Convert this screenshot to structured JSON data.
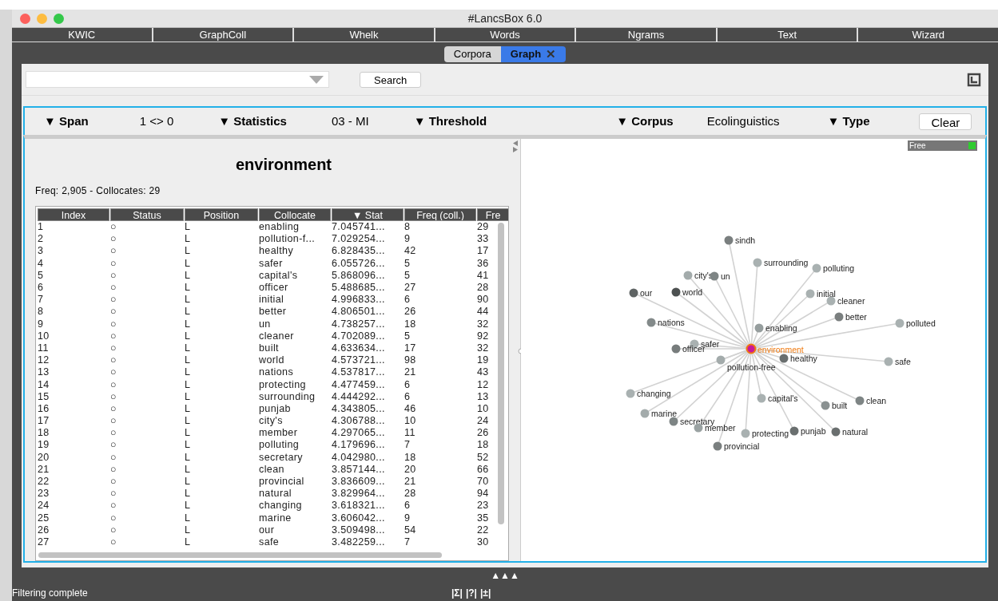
{
  "window": {
    "title": "#LancsBox 6.0"
  },
  "tools": [
    {
      "label": "KWIC",
      "selected": false
    },
    {
      "label": "GraphColl",
      "selected": false
    },
    {
      "label": "Whelk",
      "selected": false
    },
    {
      "label": "Words",
      "selected": false
    },
    {
      "label": "Ngrams",
      "selected": false
    },
    {
      "label": "Text",
      "selected": false
    },
    {
      "label": "Wizard",
      "selected": false
    }
  ],
  "subtabs": [
    {
      "label": "Corpora",
      "selected": false,
      "closable": false
    },
    {
      "label": "Graph",
      "selected": true,
      "closable": true,
      "close": "✕"
    }
  ],
  "search": {
    "button": "Search"
  },
  "filters": [
    {
      "kind": "dropdown",
      "label": "▼ Span"
    },
    {
      "kind": "value",
      "label": "1 <> 0"
    },
    {
      "kind": "dropdown",
      "label": "▼ Statistics"
    },
    {
      "kind": "value",
      "label": "03 - MI"
    },
    {
      "kind": "dropdown",
      "label": "▼ Threshold"
    },
    {
      "kind": "dropdown",
      "label": "▼ Corpus"
    },
    {
      "kind": "value",
      "label": "Ecolinguistics"
    },
    {
      "kind": "dropdown",
      "label": "▼ Type"
    },
    {
      "kind": "button",
      "label": "Clear"
    }
  ],
  "node_word": "environment",
  "summary": "Freq: 2,905 - Collocates: 29",
  "table": {
    "columns": [
      "Index",
      "Status",
      "Position",
      "Collocate",
      "▼ Stat",
      "Freq (coll.)",
      "Fre"
    ],
    "rows": [
      [
        "1",
        "○",
        "L",
        "enabling",
        "7.045741...",
        "8",
        "29"
      ],
      [
        "2",
        "○",
        "L",
        "pollution-f...",
        "7.029254...",
        "9",
        "33"
      ],
      [
        "3",
        "○",
        "L",
        "healthy",
        "6.828435...",
        "42",
        "17"
      ],
      [
        "4",
        "○",
        "L",
        "safer",
        "6.055726...",
        "5",
        "36"
      ],
      [
        "5",
        "○",
        "L",
        "capital's",
        "5.868096...",
        "5",
        "41"
      ],
      [
        "6",
        "○",
        "L",
        "officer",
        "5.488685...",
        "27",
        "28"
      ],
      [
        "7",
        "○",
        "L",
        "initial",
        "4.996833...",
        "6",
        "90"
      ],
      [
        "8",
        "○",
        "L",
        "better",
        "4.806501...",
        "26",
        "44"
      ],
      [
        "9",
        "○",
        "L",
        "un",
        "4.738257...",
        "18",
        "32"
      ],
      [
        "10",
        "○",
        "L",
        "cleaner",
        "4.702089...",
        "5",
        "92"
      ],
      [
        "11",
        "○",
        "L",
        "built",
        "4.633634...",
        "17",
        "32"
      ],
      [
        "12",
        "○",
        "L",
        "world",
        "4.573721...",
        "98",
        "19"
      ],
      [
        "13",
        "○",
        "L",
        "nations",
        "4.537817...",
        "21",
        "43"
      ],
      [
        "14",
        "○",
        "L",
        "protecting",
        "4.477459...",
        "6",
        "12"
      ],
      [
        "15",
        "○",
        "L",
        "surrounding",
        "4.444292...",
        "6",
        "13"
      ],
      [
        "16",
        "○",
        "L",
        "punjab",
        "4.343805...",
        "46",
        "10"
      ],
      [
        "17",
        "○",
        "L",
        "city's",
        "4.306788...",
        "10",
        "24"
      ],
      [
        "18",
        "○",
        "L",
        "member",
        "4.297065...",
        "11",
        "26"
      ],
      [
        "19",
        "○",
        "L",
        "polluting",
        "4.179696...",
        "7",
        "18"
      ],
      [
        "20",
        "○",
        "L",
        "secretary",
        "4.042980...",
        "18",
        "52"
      ],
      [
        "21",
        "○",
        "L",
        "clean",
        "3.857144...",
        "20",
        "66"
      ],
      [
        "22",
        "○",
        "L",
        "provincial",
        "3.836609...",
        "21",
        "70"
      ],
      [
        "23",
        "○",
        "L",
        "natural",
        "3.829964...",
        "28",
        "94"
      ],
      [
        "24",
        "○",
        "L",
        "changing",
        "3.618321...",
        "6",
        "23"
      ],
      [
        "25",
        "○",
        "L",
        "marine",
        "3.606042...",
        "9",
        "35"
      ],
      [
        "26",
        "○",
        "L",
        "our",
        "3.509498...",
        "54",
        "22"
      ],
      [
        "27",
        "○",
        "L",
        "safe",
        "3.482259...",
        "7",
        "30"
      ]
    ]
  },
  "graph": {
    "badge": "Free",
    "center": "environment",
    "nodes": [
      {
        "label": "sindh",
        "color": "#7a7f7f"
      },
      {
        "label": "surrounding",
        "color": "#a9b1b1"
      },
      {
        "label": "polluting",
        "color": "#a9b1b1"
      },
      {
        "label": "city's",
        "color": "#a3abab"
      },
      {
        "label": "un",
        "color": "#7e8585"
      },
      {
        "label": "our",
        "color": "#5f6464"
      },
      {
        "label": "world",
        "color": "#4d5151"
      },
      {
        "label": "initial",
        "color": "#a9b1b1"
      },
      {
        "label": "cleaner",
        "color": "#a9b1b1"
      },
      {
        "label": "better",
        "color": "#7a7f7f"
      },
      {
        "label": "polluted",
        "color": "#a9b1b1"
      },
      {
        "label": "nations",
        "color": "#838a8a"
      },
      {
        "label": "enabling",
        "color": "#969e9e"
      },
      {
        "label": "safer",
        "color": "#a9b1b1"
      },
      {
        "label": "officer",
        "color": "#777c7c"
      },
      {
        "label": "pollution-free",
        "color": "#a3abab"
      },
      {
        "label": "healthy",
        "color": "#6a6f6f"
      },
      {
        "label": "safe",
        "color": "#a9b1b1"
      },
      {
        "label": "changing",
        "color": "#a9b1b1"
      },
      {
        "label": "capital's",
        "color": "#a9b1b1"
      },
      {
        "label": "built",
        "color": "#8a9191"
      },
      {
        "label": "clean",
        "color": "#7e8585"
      },
      {
        "label": "marine",
        "color": "#a3abab"
      },
      {
        "label": "secretary",
        "color": "#7e8585"
      },
      {
        "label": "member",
        "color": "#9aa2a2"
      },
      {
        "label": "protecting",
        "color": "#a9b1b1"
      },
      {
        "label": "punjab",
        "color": "#6a6f6f"
      },
      {
        "label": "natural",
        "color": "#6a6f6f"
      },
      {
        "label": "provincial",
        "color": "#7a7f7f"
      }
    ]
  },
  "collapse_handle": "▲▲▲",
  "status_bar": {
    "message": "Filtering complete",
    "icons": [
      "|Σ|",
      "|?|",
      "|±|"
    ]
  }
}
